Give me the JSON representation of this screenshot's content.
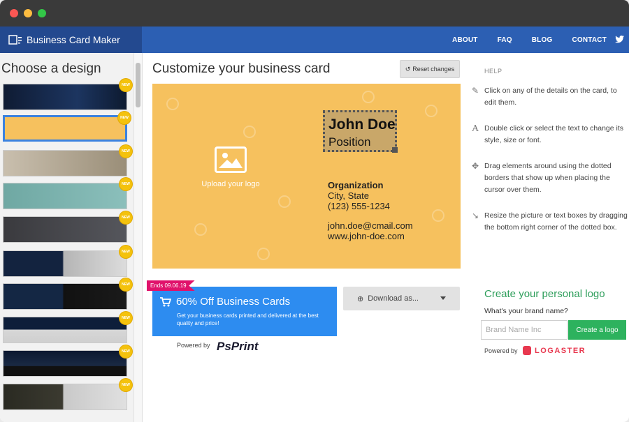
{
  "nav": {
    "brand": "Business Card Maker",
    "links": [
      "ABOUT",
      "FAQ",
      "BLOG",
      "CONTACT"
    ]
  },
  "sidebar": {
    "title": "Choose a design",
    "badge": "NEW",
    "designs": [
      {
        "bg": "linear-gradient(90deg,#0f1b33,#1c3560 60%,#0d1a30)"
      },
      {
        "bg": "#f6c15e"
      },
      {
        "bg": "linear-gradient(90deg,#c9bfae,#9a8e78)"
      },
      {
        "bg": "linear-gradient(90deg,#6fa8a3,#8bbfbb)"
      },
      {
        "bg": "linear-gradient(90deg,#3a3a3e,#55565c)"
      },
      {
        "bg": "linear-gradient(90deg,#13233f 0%,#13233f 48%,#b5b5b5 49%,#dcdcdc 100%)"
      },
      {
        "bg": "linear-gradient(90deg,#142744 0%,#142744 48%,#111 49%,#1a1a1a 100%)"
      },
      {
        "bg": "linear-gradient(180deg,#0e1e3a 0%,#0e1e3a 48%,#d7d7d7 49%,#cfcfcf 100%)"
      },
      {
        "bg": "linear-gradient(180deg,#0c1830 0%,#1a2a44 60%,#111 61%,#111 100%)"
      },
      {
        "bg": "linear-gradient(90deg,#2a2a22 0%,#3b3a30 48%,#c9c9c9 49%,#e0e0e0 100%)"
      }
    ]
  },
  "main": {
    "title": "Customize your business card",
    "reset_label": "Reset changes",
    "card": {
      "upload_label": "Upload your logo",
      "name": "John Doe",
      "position": "Position",
      "organization": "Organization",
      "city": "City, State",
      "phone": "(123) 555-1234",
      "email": "john.doe@cmail.com",
      "website": "www.john-doe.com"
    },
    "promo": {
      "tag": "Ends 09.06.19",
      "title": "60% Off Business Cards",
      "text": "Get your business cards printed and delivered at the best quality and price!",
      "powered": "Powered by",
      "partner": "PsPrint"
    },
    "download_label": "Download as..."
  },
  "help": {
    "label": "HELP",
    "items": [
      {
        "icon": "edit-icon",
        "text": "Click on any of the details on the card, to edit them."
      },
      {
        "icon": "text-style-icon",
        "text": "Double click or select the text to change its style, size or font."
      },
      {
        "icon": "move-icon",
        "text": "Drag elements around using the dotted borders that show up when placing the cursor over them."
      },
      {
        "icon": "resize-icon",
        "text": "Resize the picture or text boxes by dragging the bottom right corner of the dotted box."
      }
    ],
    "logo_title": "Create your personal logo",
    "brand_question": "What's your brand name?",
    "brand_placeholder": "Brand Name Inc",
    "create_logo_label": "Create a logo",
    "powered": "Powered by",
    "partner": "LOGASTER"
  },
  "colors": {
    "nav": "#2c5fb3",
    "card": "#f6c15e",
    "promo": "#2d8cf0",
    "logo_green": "#2db25e"
  }
}
